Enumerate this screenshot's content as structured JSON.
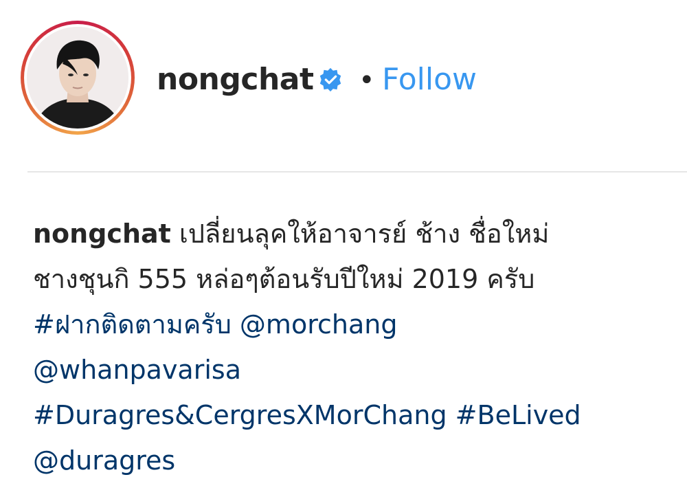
{
  "header": {
    "username": "nongchat",
    "separator": "•",
    "follow_label": "Follow"
  },
  "caption": {
    "username": "nongchat",
    "text_line1": "เปลี่ยนลุคให้อาจารย์ ช้าง ชื่อใหม่",
    "text_line2": "ชางชุนกิ 555 หล่อๆต้อนรับปีใหม่ 2019 ครับ",
    "tag_thai": "#ฝากติดตามครับ",
    "mention_morchang": "@morchang",
    "mention_whanpavarisa": "@whanpavarisa",
    "tag_duragres": "#Duragres&CergresXMorChang",
    "tag_belived": "#BeLived",
    "mention_duragres": "@duragres"
  },
  "icons": {
    "verified": "verified-badge-icon",
    "avatar": "profile-photo"
  },
  "colors": {
    "follow": "#3897f0",
    "verified": "#3897f0",
    "link": "#003569",
    "text": "#262626"
  }
}
